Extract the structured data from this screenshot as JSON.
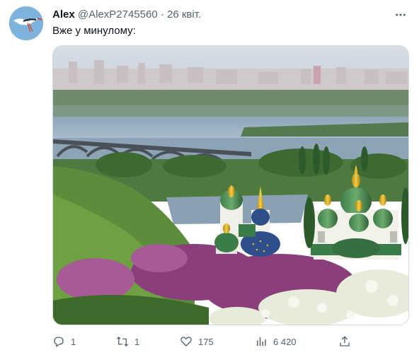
{
  "tweet": {
    "author_name": "Alex",
    "author_handle": "@AlexP2745560",
    "separator": "·",
    "date": "26 квіт.",
    "text": "Вже у минулому:",
    "media_icon": "kyiv-landscape-photo"
  },
  "actions": {
    "reply_count": "1",
    "retweet_count": "1",
    "like_count": "175",
    "views_count": "6 420"
  },
  "icons": {
    "more": "more-icon",
    "reply": "reply-icon",
    "retweet": "retweet-icon",
    "like": "heart-icon",
    "views": "views-icon",
    "share": "share-icon"
  },
  "colors": {
    "text_primary": "#0f1419",
    "text_secondary": "#536471",
    "border": "#cfd9de"
  }
}
